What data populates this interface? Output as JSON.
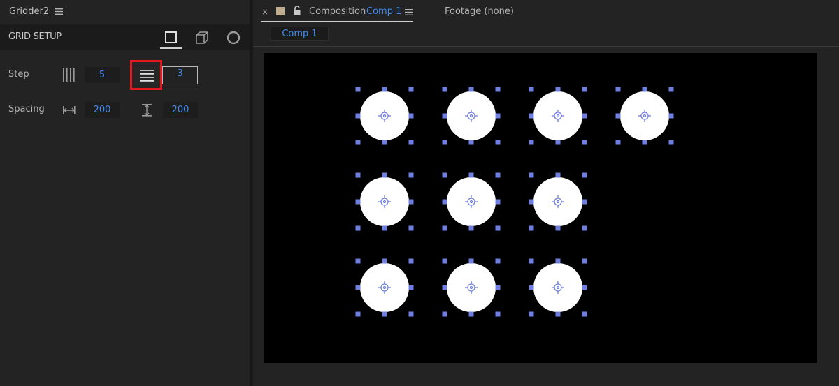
{
  "left_panel": {
    "title": "Gridder2",
    "section_label": "GRID SETUP",
    "step": {
      "label": "Step",
      "columns_value": "5",
      "rows_value": "3"
    },
    "spacing": {
      "label": "Spacing",
      "horizontal_value": "200",
      "vertical_value": "200"
    }
  },
  "right_panel": {
    "tab_close": "×",
    "tab_prefix": "Composition",
    "tab_comp_name": "Comp 1",
    "footage_tab": "Footage (none)",
    "subtab": "Comp 1"
  },
  "grid": {
    "columns": 4,
    "rows": 3,
    "row_counts": [
      4,
      3,
      3
    ]
  },
  "colors": {
    "accent_blue": "#3f8cf2",
    "highlight_red": "#e21a1f",
    "handle_color": "#6f7fe0",
    "circle_fill": "#ffffff"
  }
}
